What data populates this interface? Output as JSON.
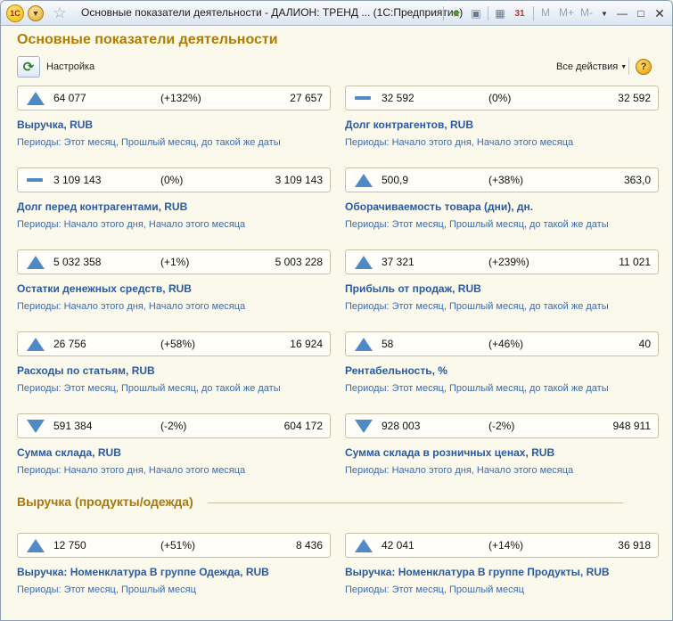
{
  "window": {
    "title": "Основные показатели деятельности - ДАЛИОН: ТРЕНД ...  (1С:Предприятие)",
    "logo_text": "1С",
    "toolbar_m": [
      "M",
      "M+",
      "M-"
    ]
  },
  "page": {
    "title": "Основные показатели деятельности",
    "settings_label": "Настройка",
    "all_actions": "Все действия",
    "help_label": "?"
  },
  "cards": [
    {
      "trend": "up",
      "current": "64 077",
      "change": "(+132%)",
      "previous": "27 657",
      "title": "Выручка, RUB",
      "periods": "Периоды: Этот месяц, Прошлый месяц, до такой же даты"
    },
    {
      "trend": "flat",
      "current": "32 592",
      "change": "(0%)",
      "previous": "32 592",
      "title": "Долг контрагентов, RUB",
      "periods": "Периоды: Начало этого дня, Начало этого месяца"
    },
    {
      "trend": "flat",
      "current": "3 109 143",
      "change": "(0%)",
      "previous": "3 109 143",
      "title": "Долг перед контрагентами, RUB",
      "periods": "Периоды: Начало этого дня, Начало этого месяца"
    },
    {
      "trend": "up",
      "current": "500,9",
      "change": "(+38%)",
      "previous": "363,0",
      "title": "Оборачиваемость товара (дни), дн.",
      "periods": "Периоды: Этот месяц, Прошлый месяц, до такой же даты"
    },
    {
      "trend": "up",
      "current": "5 032 358",
      "change": "(+1%)",
      "previous": "5 003 228",
      "title": "Остатки денежных средств, RUB",
      "periods": "Периоды: Начало этого дня, Начало этого месяца"
    },
    {
      "trend": "up",
      "current": "37 321",
      "change": "(+239%)",
      "previous": "11 021",
      "title": "Прибыль от продаж, RUB",
      "periods": "Периоды: Этот месяц, Прошлый месяц, до такой же даты"
    },
    {
      "trend": "up",
      "current": "26 756",
      "change": "(+58%)",
      "previous": "16 924",
      "title": "Расходы по статьям, RUB",
      "periods": "Периоды: Этот месяц, Прошлый месяц, до такой же даты"
    },
    {
      "trend": "up",
      "current": "58",
      "change": "(+46%)",
      "previous": "40",
      "title": "Рентабельность, %",
      "periods": "Периоды: Этот месяц, Прошлый месяц, до такой же даты"
    },
    {
      "trend": "down",
      "current": "591 384",
      "change": "(-2%)",
      "previous": "604 172",
      "title": "Сумма склада, RUB",
      "periods": "Периоды: Начало этого дня, Начало этого месяца"
    },
    {
      "trend": "down",
      "current": "928 003",
      "change": "(-2%)",
      "previous": "948 911",
      "title": "Сумма склада в розничных ценах, RUB",
      "periods": "Периоды: Начало этого дня, Начало этого месяца"
    }
  ],
  "section": {
    "title": "Выручка (продукты/одежда)",
    "cards": [
      {
        "trend": "up",
        "current": "12 750",
        "change": "(+51%)",
        "previous": "8 436",
        "title": "Выручка: Номенклатура В группе Одежда, RUB",
        "periods": "Периоды: Этот месяц, Прошлый месяц"
      },
      {
        "trend": "up",
        "current": "42 041",
        "change": "(+14%)",
        "previous": "36 918",
        "title": "Выручка: Номенклатура В группе Продукты, RUB",
        "periods": "Периоды: Этот месяц, Прошлый месяц"
      }
    ]
  }
}
